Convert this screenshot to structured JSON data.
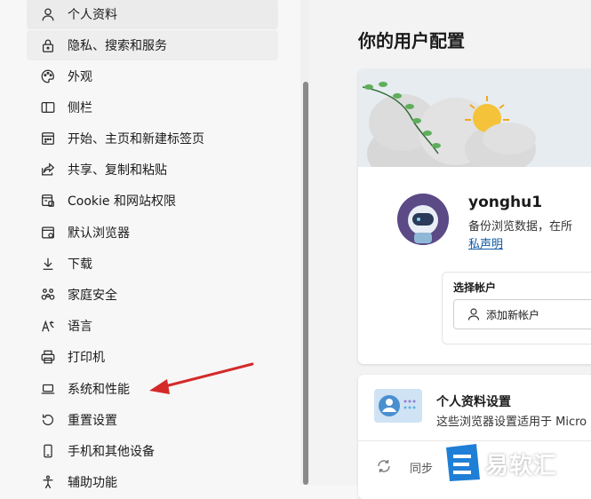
{
  "sidebar": {
    "items": [
      {
        "label": "个人资料",
        "icon": "person-icon"
      },
      {
        "label": "隐私、搜索和服务",
        "icon": "lock-icon"
      },
      {
        "label": "外观",
        "icon": "palette-icon"
      },
      {
        "label": "侧栏",
        "icon": "sidebar-icon"
      },
      {
        "label": "开始、主页和新建标签页",
        "icon": "home-grid-icon"
      },
      {
        "label": "共享、复制和粘贴",
        "icon": "share-icon"
      },
      {
        "label": "Cookie 和网站权限",
        "icon": "site-permissions-icon"
      },
      {
        "label": "默认浏览器",
        "icon": "browser-icon"
      },
      {
        "label": "下载",
        "icon": "download-icon"
      },
      {
        "label": "家庭安全",
        "icon": "family-icon"
      },
      {
        "label": "语言",
        "icon": "language-icon"
      },
      {
        "label": "打印机",
        "icon": "printer-icon"
      },
      {
        "label": "系统和性能",
        "icon": "laptop-icon"
      },
      {
        "label": "重置设置",
        "icon": "reset-icon"
      },
      {
        "label": "手机和其他设备",
        "icon": "phone-icon"
      },
      {
        "label": "辅助功能",
        "icon": "accessibility-icon"
      }
    ]
  },
  "main": {
    "title": "你的用户配置",
    "profile": {
      "username": "yonghu1",
      "sync_desc": "备份浏览数据，在所",
      "privacy_link": "私声明",
      "account_label": "选择帐户",
      "add_account": "添加新帐户"
    },
    "settings_card": {
      "title": "个人资料设置",
      "desc": "这些浏览器设置适用于 Micro",
      "sync_label": "同步"
    }
  },
  "watermark": {
    "text": "易软汇"
  },
  "colors": {
    "accent": "#1e63b5",
    "link": "#0f5ba7",
    "arrow": "#d42a2a"
  }
}
